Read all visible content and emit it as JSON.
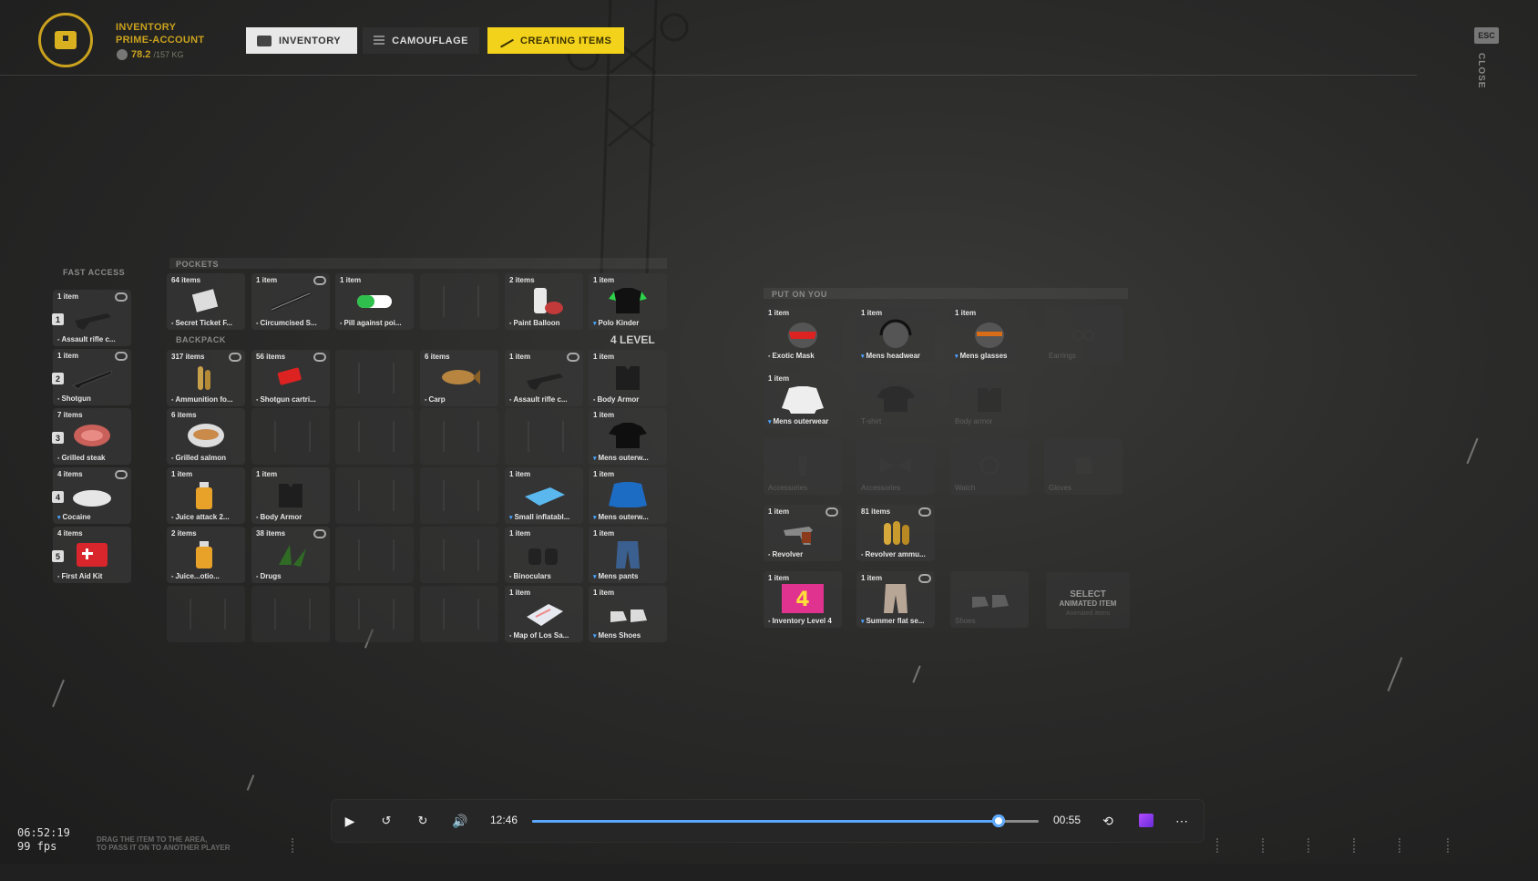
{
  "header": {
    "title_line1": "INVENTORY",
    "title_line2": "PRIME-ACCOUNT",
    "weight": "78.2",
    "weight_max": "/157 KG",
    "esc": "ESC",
    "close": "CLOSE"
  },
  "tabs": [
    {
      "label": "INVENTORY",
      "icon": "inventory-icon"
    },
    {
      "label": "CAMOUFLAGE",
      "icon": "camouflage-icon"
    },
    {
      "label": "CREATING ITEMS",
      "icon": "crafting-icon"
    }
  ],
  "sections": {
    "fast_access": "FAST ACCESS",
    "pockets": "POCKETS",
    "backpack": "BACKPACK",
    "put_on_you": "PUT ON YOU",
    "level": "4 LEVEL"
  },
  "fast_access": [
    {
      "slot": "1",
      "count": "1 item",
      "name": "Assault rifle c...",
      "icon": "rifle-icon"
    },
    {
      "slot": "2",
      "count": "1 item",
      "name": "Shotgun",
      "icon": "shotgun-icon"
    },
    {
      "slot": "3",
      "count": "7 items",
      "name": "Grilled steak",
      "icon": "steak-icon"
    },
    {
      "slot": "4",
      "count": "4 items",
      "name": "Cocaine",
      "icon": "powder-icon"
    },
    {
      "slot": "5",
      "count": "4 items",
      "name": "First Aid Kit",
      "icon": "medkit-icon"
    }
  ],
  "pockets": [
    {
      "count": "64 items",
      "name": "Secret Ticket F...",
      "icon": "ticket-icon"
    },
    {
      "count": "1 item",
      "name": "Circumcised S...",
      "icon": "tool-icon"
    },
    {
      "count": "1 item",
      "name": "Pill against poi...",
      "icon": "pill-icon"
    },
    {
      "count": "",
      "name": "",
      "icon": ""
    },
    {
      "count": "2 items",
      "name": "Paint Balloon",
      "icon": "spray-can-icon"
    },
    {
      "count": "1 item",
      "name": "Polo Kinder",
      "icon": "polo-shirt-icon"
    }
  ],
  "backpack": [
    {
      "count": "317 items",
      "name": "Ammunition fo...",
      "icon": "ammo-icon"
    },
    {
      "count": "56 items",
      "name": "Shotgun cartri...",
      "icon": "shell-icon"
    },
    {
      "count": "",
      "name": "",
      "icon": ""
    },
    {
      "count": "6 items",
      "name": "Carp",
      "icon": "fish-icon"
    },
    {
      "count": "1 item",
      "name": "Assault rifle c...",
      "icon": "rifle-icon"
    },
    {
      "count": "1 item",
      "name": "Body Armor",
      "icon": "armor-icon"
    },
    {
      "count": "6 items",
      "name": "Grilled salmon",
      "icon": "salmon-icon"
    },
    {
      "count": "",
      "name": "",
      "icon": ""
    },
    {
      "count": "",
      "name": "",
      "icon": ""
    },
    {
      "count": "",
      "name": "",
      "icon": ""
    },
    {
      "count": "",
      "name": "",
      "icon": ""
    },
    {
      "count": "1 item",
      "name": "Mens outerw...",
      "icon": "tshirt-icon"
    },
    {
      "count": "1 item",
      "name": "Juice attack 2...",
      "icon": "bottle-icon"
    },
    {
      "count": "1 item",
      "name": "Body Armor",
      "icon": "armor-icon"
    },
    {
      "count": "",
      "name": "",
      "icon": ""
    },
    {
      "count": "",
      "name": "",
      "icon": ""
    },
    {
      "count": "1 item",
      "name": "Small inflatabl...",
      "icon": "mattress-icon"
    },
    {
      "count": "1 item",
      "name": "Mens outerw...",
      "icon": "jacket-icon"
    },
    {
      "count": "2 items",
      "name": "Juice...otio...",
      "icon": "bottle-icon"
    },
    {
      "count": "38 items",
      "name": "Drugs",
      "icon": "leaf-icon"
    },
    {
      "count": "",
      "name": "",
      "icon": ""
    },
    {
      "count": "",
      "name": "",
      "icon": ""
    },
    {
      "count": "1 item",
      "name": "Binoculars",
      "icon": "binoculars-icon"
    },
    {
      "count": "1 item",
      "name": "Mens pants",
      "icon": "pants-icon"
    },
    {
      "count": "",
      "name": "",
      "icon": ""
    },
    {
      "count": "",
      "name": "",
      "icon": ""
    },
    {
      "count": "",
      "name": "",
      "icon": ""
    },
    {
      "count": "",
      "name": "",
      "icon": ""
    },
    {
      "count": "1 item",
      "name": "Map of Los Sa...",
      "icon": "map-icon"
    },
    {
      "count": "1 item",
      "name": "Mens Shoes",
      "icon": "shoes-icon"
    }
  ],
  "equipped": [
    {
      "count": "1 item",
      "name": "Exotic Mask",
      "icon": "mask-icon"
    },
    {
      "count": "1 item",
      "name": "Mens headwear",
      "icon": "headphones-icon"
    },
    {
      "count": "1 item",
      "name": "Mens glasses",
      "icon": "glasses-icon"
    },
    {
      "count": "",
      "name": "Earrings",
      "icon": "earrings-icon"
    },
    {
      "count": "1 item",
      "name": "Mens outerwear",
      "icon": "sweatshirt-icon"
    },
    {
      "count": "",
      "name": "T-shirt",
      "icon": "tshirt-icon"
    },
    {
      "count": "",
      "name": "Body armor",
      "icon": "armor-icon"
    },
    {
      "count": "",
      "name": "",
      "icon": ""
    },
    {
      "count": "",
      "name": "Accessories",
      "icon": "accessory-icon"
    },
    {
      "count": "",
      "name": "Accessories",
      "icon": "bowtie-icon"
    },
    {
      "count": "",
      "name": "Watch",
      "icon": "watch-icon"
    },
    {
      "count": "",
      "name": "Gloves",
      "icon": "gloves-icon"
    },
    {
      "count": "1 item",
      "name": "Revolver",
      "icon": "revolver-icon"
    },
    {
      "count": "81 items",
      "name": "Revolver ammu...",
      "icon": "bullets-icon"
    },
    {
      "count": "",
      "name": "",
      "icon": ""
    },
    {
      "count": "",
      "name": "",
      "icon": ""
    },
    {
      "count": "1 item",
      "name": "Inventory Level 4",
      "icon": "level-badge-icon"
    },
    {
      "count": "1 item",
      "name": "Summer flat se...",
      "icon": "trousers-icon"
    },
    {
      "count": "",
      "name": "Shoes",
      "icon": "shoes-icon"
    },
    {
      "count": "",
      "name": "",
      "icon": ""
    }
  ],
  "select_animated": {
    "line1": "SELECT",
    "line2": "ANIMATED ITEM",
    "line3": "Animated items"
  },
  "overlay": {
    "clock": "06:52:19",
    "fps": "99 fps",
    "hint_line1": "DRAG THE ITEM TO THE AREA,",
    "hint_line2": "TO PASS IT ON TO ANOTHER PLAYER"
  },
  "player": {
    "current_time": "12:46",
    "remaining_time": "00:55",
    "progress": 0.92,
    "accent": "#5aa8ff"
  }
}
